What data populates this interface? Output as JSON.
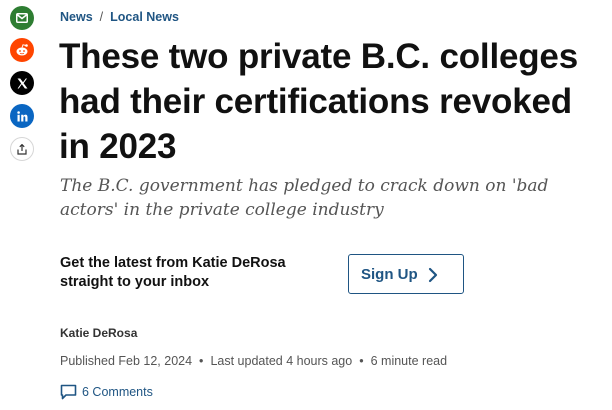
{
  "share": {
    "icons": [
      "email-icon",
      "reddit-icon",
      "x-icon",
      "linkedin-icon",
      "share-icon"
    ],
    "colors": {
      "email": "#2e7d32",
      "reddit": "#ff4500",
      "x": "#000000",
      "linkedin": "#0a66c2"
    }
  },
  "breadcrumb": {
    "items": [
      "News",
      "Local News"
    ],
    "separator": "/"
  },
  "article": {
    "headline": "These two private B.C. colleges had their certifications revoked in 2023",
    "deck": "The B.C. government has pledged to crack down on 'bad actors' in the private college industry",
    "author": "Katie DeRosa",
    "published": "Published Feb 12, 2024",
    "updated": "Last updated 4 hours ago",
    "read_time": "6 minute read",
    "comments": "6 Comments"
  },
  "newsletter": {
    "promo": "Get the latest from Katie DeRosa straight to your inbox",
    "button_label": "Sign Up"
  },
  "colors": {
    "link": "#1f5583",
    "text": "#111111",
    "deck": "#555555"
  }
}
